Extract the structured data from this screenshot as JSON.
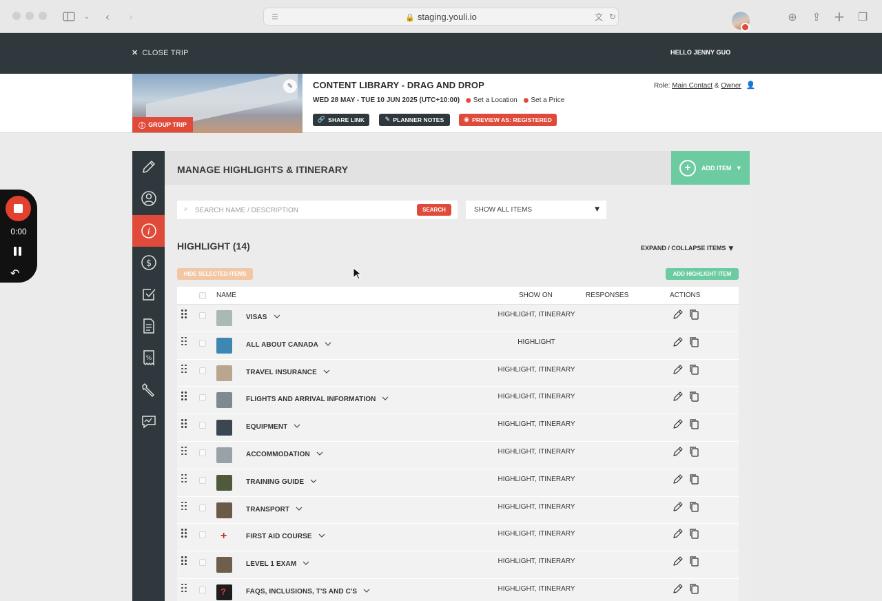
{
  "browser": {
    "url": "staging.youli.io"
  },
  "header": {
    "close_label": "CLOSE TRIP",
    "greeting": "HELLO JENNY GUO"
  },
  "trip": {
    "badge": "GROUP TRIP",
    "title": "CONTENT LIBRARY - DRAG AND DROP",
    "dates": "WED 28 MAY - TUE 10 JUN 2025 (UTC+10:00)",
    "location_link": "Set a Location",
    "price_link": "Set a Price",
    "role_prefix": "Role:",
    "role_main": "Main Contact",
    "role_sep": "&",
    "role_owner": "Owner",
    "buttons": {
      "share": "SHARE LINK",
      "notes": "PLANNER NOTES",
      "preview": "PREVIEW AS: REGISTERED"
    }
  },
  "sidebar": {
    "items": [
      "edit",
      "people",
      "info",
      "pricing",
      "checklist",
      "document",
      "voucher",
      "tools",
      "feedback"
    ],
    "active": "info"
  },
  "panel": {
    "title": "MANAGE HIGHLIGHTS & ITINERARY",
    "add_item": "ADD ITEM",
    "search_placeholder": "SEARCH NAME / DESCRIPTION",
    "search_button": "SEARCH",
    "filter_value": "SHOW ALL ITEMS",
    "section_title": "HIGHLIGHT (14)",
    "expand_label": "EXPAND / COLLAPSE ITEMS",
    "hide_selected": "HIDE SELECTED ITEMS",
    "add_highlight": "ADD HIGHLIGHT ITEM"
  },
  "table": {
    "headers": {
      "name": "NAME",
      "show_on": "SHOW ON",
      "responses": "RESPONSES",
      "actions": "ACTIONS"
    },
    "rows": [
      {
        "name": "VISAS",
        "show_on": "HIGHLIGHT, ITINERARY",
        "thumb": "#a9b9b5"
      },
      {
        "name": "ALL ABOUT CANADA",
        "show_on": "HIGHLIGHT",
        "thumb": "#3f86b3"
      },
      {
        "name": "TRAVEL INSURANCE",
        "show_on": "HIGHLIGHT, ITINERARY",
        "thumb": "#b9a690"
      },
      {
        "name": "FLIGHTS AND ARRIVAL INFORMATION",
        "show_on": "HIGHLIGHT, ITINERARY",
        "thumb": "#7d8a92"
      },
      {
        "name": "EQUIPMENT",
        "show_on": "HIGHLIGHT, ITINERARY",
        "thumb": "#3b4650"
      },
      {
        "name": "ACCOMMODATION",
        "show_on": "HIGHLIGHT, ITINERARY",
        "thumb": "#9aa2a8"
      },
      {
        "name": "TRAINING GUIDE",
        "show_on": "HIGHLIGHT, ITINERARY",
        "thumb": "#4f5a3c"
      },
      {
        "name": "TRANSPORT",
        "show_on": "HIGHLIGHT, ITINERARY",
        "thumb": "#6b5a4a"
      },
      {
        "name": "FIRST AID COURSE",
        "show_on": "HIGHLIGHT, ITINERARY",
        "thumb": "first-aid"
      },
      {
        "name": "LEVEL 1 EXAM",
        "show_on": "HIGHLIGHT, ITINERARY",
        "thumb": "#6e5e4c"
      },
      {
        "name": "FAQS, INCLUSIONS, T'S AND C'S",
        "show_on": "HIGHLIGHT, ITINERARY",
        "thumb": "faq"
      }
    ]
  },
  "recorder": {
    "time": "0:00"
  },
  "colors": {
    "brand_red": "#e04a3b",
    "brand_green": "#6ccba1",
    "dark": "#2f383d"
  }
}
